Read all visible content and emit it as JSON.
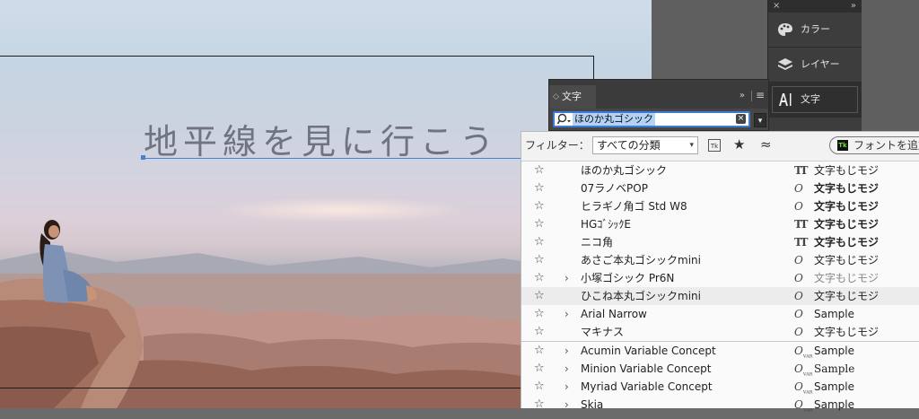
{
  "canvas": {
    "headline": "地平線を見に行こう"
  },
  "dock": {
    "close_glyph": "×",
    "collapse_glyph": "»",
    "items": [
      {
        "label": "カラー",
        "icon": "palette-icon"
      },
      {
        "label": "レイヤー",
        "icon": "layers-icon"
      },
      {
        "label": "文字",
        "icon": "character-icon"
      }
    ]
  },
  "character_panel": {
    "tab_label": "文字",
    "tab_arrows": "◇",
    "menu_glyph": "»",
    "hamburger_glyph": "≡",
    "search_value": "ほのか丸ゴシック",
    "clear_glyph": "×",
    "dropdown_glyph": "▾"
  },
  "font_popup": {
    "filter_label": "フィルター：",
    "filter_value": "すべての分類",
    "filter_chev": "▾",
    "typekit_glyph": "Tk",
    "favorite_glyph": "★",
    "similar_glyph": "≈",
    "add_fonts_label": "フォントを追加",
    "add_fonts_tk": "Tk",
    "star_glyph": "☆",
    "expander_glyph": "›",
    "fonts": [
      {
        "name": "ほのか丸ゴシック",
        "type": "TT",
        "sample": "文字もじモジ",
        "style": "normal",
        "expand": false
      },
      {
        "name": "07ラノベPOP",
        "type": "O",
        "sample": "文字もじモジ",
        "style": "bold",
        "expand": false
      },
      {
        "name": "ヒラギノ角ゴ Std W8",
        "type": "O",
        "sample": "文字もじモジ",
        "style": "bold",
        "expand": false
      },
      {
        "name": "HGｺﾞｼｯｸE",
        "type": "TT",
        "sample": "文字もじモジ",
        "style": "bold",
        "expand": false
      },
      {
        "name": "ニコ角",
        "type": "TT",
        "sample": "文字もじモジ",
        "style": "bold",
        "expand": false
      },
      {
        "name": "あさご本丸ゴシックmini",
        "type": "O",
        "sample": "文字もじモジ",
        "style": "normal",
        "expand": false
      },
      {
        "name": "小塚ゴシック Pr6N",
        "type": "O",
        "sample": "文字もじモジ",
        "style": "light",
        "expand": true
      },
      {
        "name": "ひこね本丸ゴシックmini",
        "type": "O",
        "sample": "文字もじモジ",
        "style": "normal",
        "expand": false
      },
      {
        "name": "Arial Narrow",
        "type": "O",
        "sample": "Sample",
        "style": "normal",
        "expand": true
      },
      {
        "name": "マキナス",
        "type": "O",
        "sample": "文字もじモジ",
        "style": "normal",
        "expand": false
      },
      {
        "name": "Acumin Variable Concept",
        "type": "VAR",
        "sample": "Sample",
        "style": "normal",
        "expand": true
      },
      {
        "name": "Minion Variable Concept",
        "type": "VAR",
        "sample": "Sample",
        "style": "serif",
        "expand": true
      },
      {
        "name": "Myriad Variable Concept",
        "type": "VAR",
        "sample": "Sample",
        "style": "normal",
        "expand": true
      },
      {
        "name": "Skia",
        "type": "VAR",
        "sample": "Sample",
        "style": "normal",
        "expand": true
      }
    ],
    "type_glyphs": {
      "TT": "TT",
      "O": "O",
      "VAR": "O"
    },
    "var_sub": "VAR"
  },
  "colors": {
    "selection": "#3d7bd4",
    "panel_dark": "#3d3d3d",
    "list_bg": "#fafafa"
  }
}
